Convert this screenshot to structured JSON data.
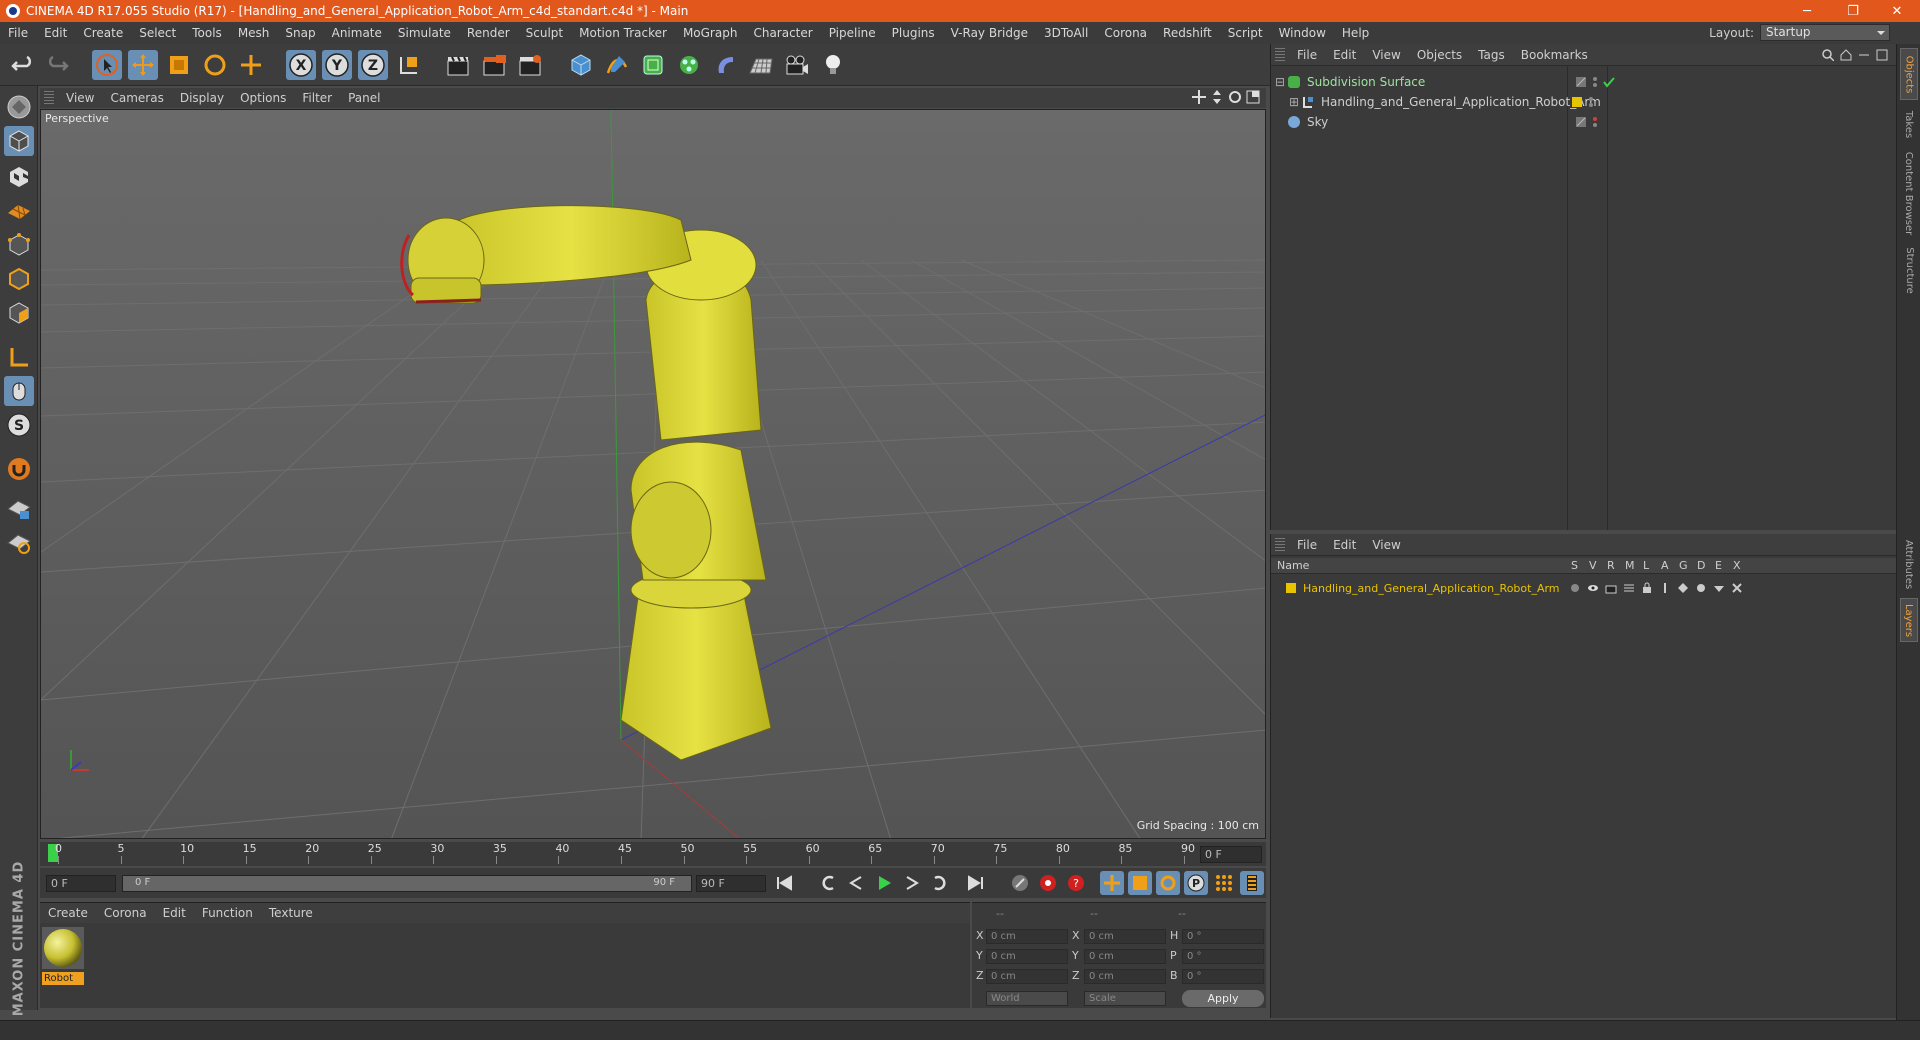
{
  "window": {
    "title": "CINEMA 4D R17.055 Studio (R17) - [Handling_and_General_Application_Robot_Arm_c4d_standart.c4d *] - Main",
    "minimize": "─",
    "restore": "❐",
    "close": "✕"
  },
  "menu": [
    "File",
    "Edit",
    "Create",
    "Select",
    "Tools",
    "Mesh",
    "Snap",
    "Animate",
    "Simulate",
    "Render",
    "Sculpt",
    "Motion Tracker",
    "MoGraph",
    "Character",
    "Pipeline",
    "Plugins",
    "V-Ray Bridge",
    "3DToAll",
    "Corona",
    "Redshift",
    "Script",
    "Window",
    "Help"
  ],
  "layout": {
    "label": "Layout:",
    "value": "Startup"
  },
  "toolbar": {
    "x_label": "X",
    "y_label": "Y",
    "z_label": "Z"
  },
  "viewport": {
    "menu": [
      "View",
      "Cameras",
      "Display",
      "Options",
      "Filter",
      "Panel"
    ],
    "label": "Perspective",
    "grid_spacing": "Grid Spacing : 100 cm"
  },
  "timeline": {
    "ticks": [
      "0",
      "5",
      "10",
      "15",
      "20",
      "25",
      "30",
      "35",
      "40",
      "45",
      "50",
      "55",
      "60",
      "65",
      "70",
      "75",
      "80",
      "85",
      "90"
    ],
    "end_field": "0 F"
  },
  "transport": {
    "start": "0 F",
    "range_start": "0 F",
    "range_end": "90 F",
    "end": "90 F"
  },
  "materials": {
    "menu": [
      "Create",
      "Corona",
      "Edit",
      "Function",
      "Texture"
    ],
    "items": [
      {
        "name": "Robot"
      }
    ]
  },
  "coords": {
    "headers": [
      "--",
      "--",
      "--"
    ],
    "rows": [
      {
        "a": "X",
        "av": "0 cm",
        "b": "X",
        "bv": "0 cm",
        "c": "H",
        "cv": "0 °"
      },
      {
        "a": "Y",
        "av": "0 cm",
        "b": "Y",
        "bv": "0 cm",
        "c": "P",
        "cv": "0 °"
      },
      {
        "a": "Z",
        "av": "0 cm",
        "b": "Z",
        "bv": "0 cm",
        "c": "B",
        "cv": "0 °"
      }
    ],
    "world": "World",
    "scale": "Scale",
    "apply": "Apply"
  },
  "objects": {
    "menu": [
      "File",
      "Edit",
      "View",
      "Objects",
      "Tags",
      "Bookmarks"
    ],
    "items": [
      {
        "name": "Subdivision Surface",
        "color": "#9fe0a0"
      },
      {
        "name": "Handling_and_General_Application_Robot_Arm",
        "color": "#cfcfcf"
      },
      {
        "name": "Sky",
        "color": "#cfcfcf"
      }
    ]
  },
  "layers": {
    "menu": [
      "File",
      "Edit",
      "View"
    ],
    "columns": [
      "Name",
      "S",
      "V",
      "R",
      "M",
      "L",
      "A",
      "G",
      "D",
      "E",
      "X"
    ],
    "items": [
      {
        "name": "Handling_and_General_Application_Robot_Arm",
        "color": "#e8c300"
      }
    ]
  },
  "side_tabs": [
    "Objects",
    "Takes",
    "Content Browser",
    "Structure",
    "Attributes",
    "Layers"
  ],
  "branding": "MAXON CINEMA 4D",
  "colors": {
    "accent": "#e2581c",
    "active": "#6a8fb4",
    "robot": "#e0dc3a"
  }
}
